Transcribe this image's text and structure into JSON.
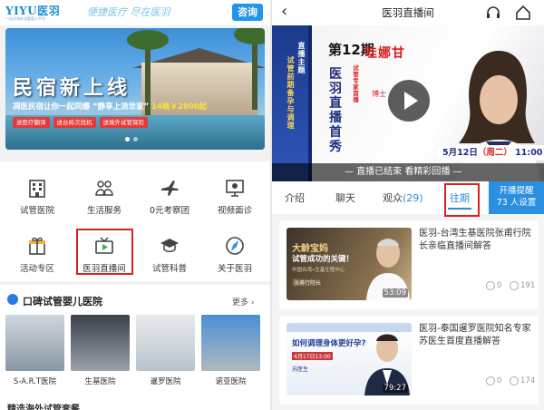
{
  "left": {
    "header": {
      "logo": "YIYU医羽",
      "logo_sub": "一站式海外试管婴儿平台",
      "slogan": "便捷医疗 尽在医羽",
      "consult_label": "咨询"
    },
    "banner": {
      "title": "民宿新上线",
      "line_main": "凋医民宿让你一起同爆",
      "line_mid": "“静享上流世家”",
      "line_price": "14晚￥2800起",
      "tags": [
        "送医疗翻译",
        "送台局次找机",
        "送境外试管保险"
      ]
    },
    "grid": [
      {
        "label": "试管医院",
        "icon": "hospital-icon"
      },
      {
        "label": "生活服务",
        "icon": "people-icon"
      },
      {
        "label": "0元考察团",
        "icon": "airplane-icon"
      },
      {
        "label": "视频面诊",
        "icon": "video-consult-icon"
      },
      {
        "label": "活动专区",
        "icon": "gift-icon"
      },
      {
        "label": "医羽直播间",
        "icon": "tv-play-icon"
      },
      {
        "label": "试管科普",
        "icon": "graduation-cap-icon"
      },
      {
        "label": "关于医羽",
        "icon": "compass-icon"
      }
    ],
    "hospitals": {
      "title": "口碑试管婴儿医院",
      "more_label": "更多",
      "items": [
        "S-A.R.T医院",
        "生基医院",
        "暹罗医院",
        "诺亚医院"
      ],
      "next_title": "精选海外试管套餐"
    }
  },
  "right": {
    "header": {
      "title": "医羽直播间"
    },
    "video": {
      "issue": "第12期",
      "show_name": "医羽直播首秀",
      "vert_1": "试管前期备孕与调理",
      "vert_2": "直播主题",
      "vert_3": "试管专家首播",
      "host": "哇娜甘",
      "host_title": "博士",
      "date": "5月12日",
      "weekday": "（周二）",
      "time": "11:00",
      "status_text": "— 直播已结束 看精彩回播 —"
    },
    "tabs": {
      "intro": "介绍",
      "chat": "聊天",
      "audience": "观众",
      "audience_count": "(29)",
      "past": "往期",
      "remind_line1": "开播提醒",
      "remind_line2": "73 人设置"
    },
    "playbacks": [
      {
        "title": "医羽-台湾生基医院张甫行院长亲临直播间解答",
        "duration": "53:09",
        "comments": "0",
        "views": "191",
        "thumb_title": "大龄宝妈",
        "thumb_title2": "试管成功的关键！",
        "thumb_sub": "中国台湾•生基生殖中心",
        "thumb_name": "张甫行院长"
      },
      {
        "title": "医羽-泰国暹罗医院知名专家苏医生首度直播解答",
        "duration": "79:27",
        "comments": "0",
        "views": "174",
        "thumb_title": "如何调理身体更好孕?",
        "thumb_date": "4月17日13:00",
        "thumb_name": "苏医生"
      }
    ]
  },
  "colors": {
    "accent": "#2a8fe0",
    "highlight": "#e02020",
    "banner_price": "#ffe03a"
  }
}
